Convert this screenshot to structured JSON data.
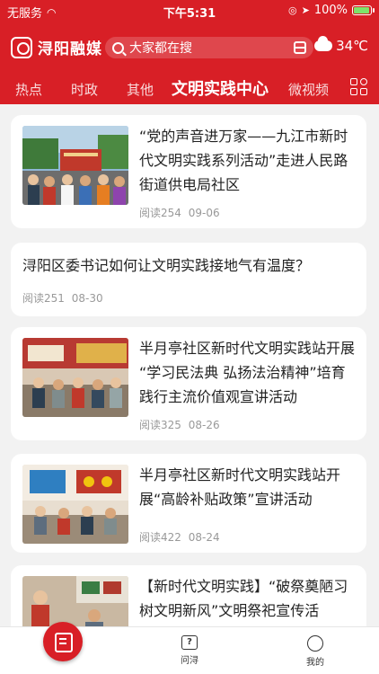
{
  "status": {
    "carrier": "无服务",
    "time": "下午5:31",
    "battery": "100%"
  },
  "header": {
    "logo": "浔阳融媒",
    "search_placeholder": "大家都在搜",
    "temperature": "34℃"
  },
  "tabs": [
    "热点",
    "时政",
    "其他",
    "文明实践中心",
    "微视频"
  ],
  "active_tab": "文明实践中心",
  "articles": [
    {
      "title": "“党的声音进万家——九江市新时代文明实践系列活动”走进人民路街道供电局社区",
      "reads": "阅读254",
      "date": "09-06"
    },
    {
      "title": "浔阳区委书记如何让文明实践接地气有温度？",
      "reads": "阅读251",
      "date": "08-30"
    },
    {
      "title": "半月亭社区新时代文明实践站开展 “学习民法典 弘扬法治精神”培育践行主流价值观宣讲活动",
      "reads": "阅读325",
      "date": "08-26"
    },
    {
      "title": "半月亭社区新时代文明实践站开展“高龄补贴政策”宣讲活动",
      "reads": "阅读422",
      "date": "08-24"
    },
    {
      "title": "【新时代文明实践】“破祭奠陋习 树文明新风”文明祭祀宣传活",
      "reads": "",
      "date": ""
    }
  ],
  "tabbar": {
    "ask": "问浔",
    "me": "我的"
  },
  "colors": {
    "brand": "#d81f26"
  }
}
